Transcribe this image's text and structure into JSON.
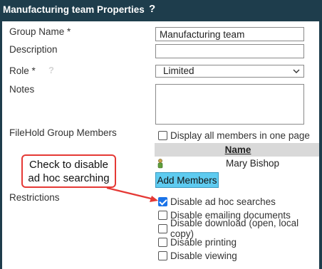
{
  "header": {
    "title": "Manufacturing team Properties",
    "help": "?"
  },
  "form": {
    "group_name_label": "Group Name *",
    "group_name_value": "Manufacturing team",
    "description_label": "Description",
    "description_value": "",
    "role_label": "Role *",
    "role_help": "?",
    "role_value": "Limited",
    "notes_label": "Notes",
    "notes_value": ""
  },
  "members": {
    "label": "FileHold Group Members",
    "show_all_label": "Display all members in one page",
    "show_all_checked": false,
    "column_name": "Name",
    "rows": [
      {
        "name": "Mary Bishop",
        "icon": "person-icon"
      }
    ],
    "add_button": "Add Members"
  },
  "restrictions": {
    "label": "Restrictions",
    "items": [
      {
        "label": "Disable ad hoc searches",
        "checked": true
      },
      {
        "label": "Disable emailing documents",
        "checked": false
      },
      {
        "label": "Disable download (open, local copy)",
        "checked": false
      },
      {
        "label": "Disable printing",
        "checked": false
      },
      {
        "label": "Disable viewing",
        "checked": false
      }
    ]
  },
  "callout": {
    "line1": "Check to disable",
    "line2": "ad hoc searching"
  },
  "colors": {
    "title_bar": "#1e3d4c",
    "button": "#5ecbf0",
    "callout_border": "#e53935",
    "checkbox_on": "#1a73e8"
  }
}
